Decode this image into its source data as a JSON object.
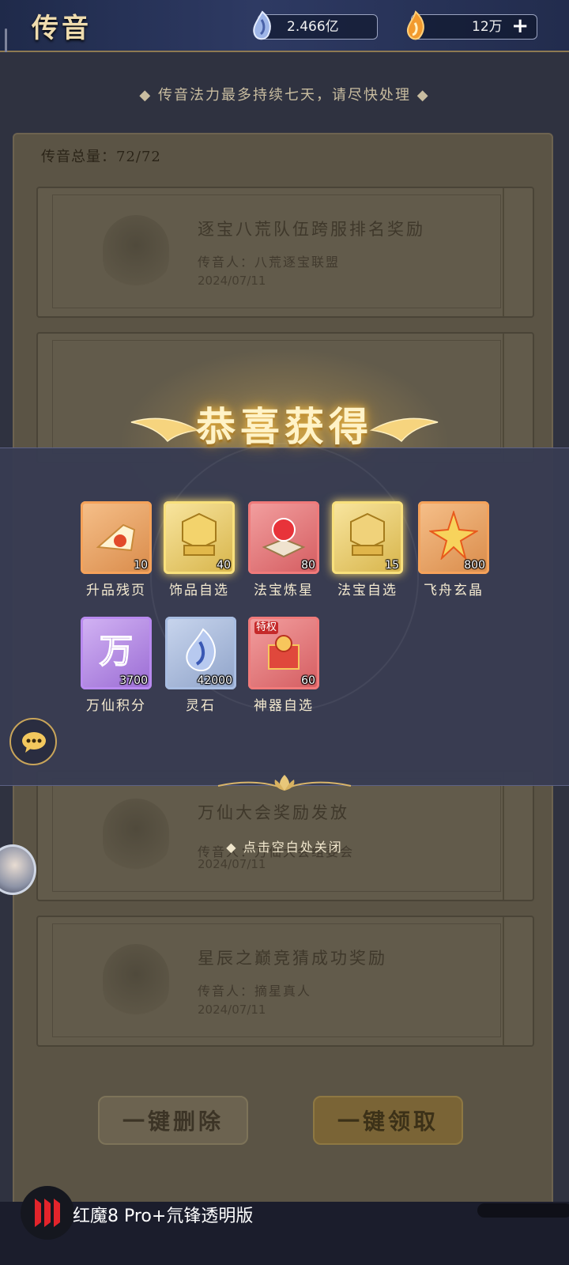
{
  "header": {
    "title": "传音",
    "spirit_stone": "2.466亿",
    "fire_currency": "12万",
    "plus_label": "+"
  },
  "notice": "◆ 传音法力最多持续七天，请尽快处理 ◆",
  "mail_total": "传音总量：72/72",
  "mails": [
    {
      "title": "逐宝八荒队伍跨服排名奖励",
      "sender": "传音人：八荒逐宝联盟",
      "date": "2024/07/11"
    },
    {
      "title": "万仙大会奖励发放",
      "sender": "传音人：万仙大会组委会",
      "date": "2024/07/11"
    },
    {
      "title": "星辰之巅竞猜成功奖励",
      "sender": "传音人：摘星真人",
      "date": "2024/07/11"
    }
  ],
  "buttons": {
    "delete_all": "一键删除",
    "claim_all": "一键领取"
  },
  "reward_popup": {
    "title": "恭喜获得",
    "close_hint": "◆ 点击空白处关闭",
    "items": [
      {
        "name": "升品残页",
        "qty": "10",
        "quality": "orange",
        "icon": "torn-page-icon"
      },
      {
        "name": "饰品自选",
        "qty": "40",
        "quality": "gold",
        "icon": "ornament-chest-icon"
      },
      {
        "name": "法宝炼星",
        "qty": "80",
        "quality": "red",
        "icon": "star-refine-icon"
      },
      {
        "name": "法宝自选",
        "qty": "15",
        "quality": "gold",
        "icon": "treasure-chest-icon"
      },
      {
        "name": "飞舟玄晶",
        "qty": "800",
        "quality": "orange",
        "icon": "crystal-star-icon"
      },
      {
        "name": "万仙积分",
        "qty": "3700",
        "quality": "purple",
        "icon": "wan-token-icon"
      },
      {
        "name": "灵石",
        "qty": "42000",
        "quality": "blue",
        "icon": "spirit-stone-icon"
      },
      {
        "name": "神器自选",
        "qty": "60",
        "quality": "red",
        "icon": "artifact-box-icon",
        "tag": "特权"
      }
    ]
  },
  "watermark": "红魔8 Pro+氘锋透明版",
  "colors": {
    "gold": "#efdcae",
    "panel": "#383c52",
    "accent_orange": "#f5a25a"
  }
}
